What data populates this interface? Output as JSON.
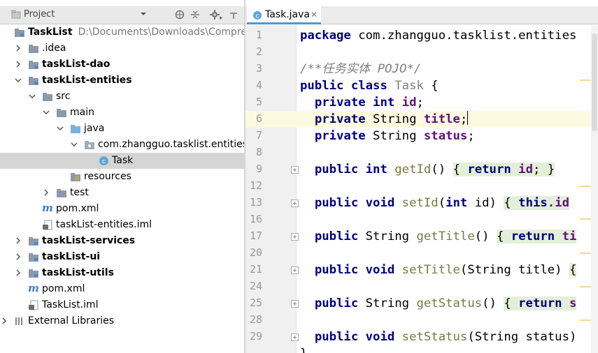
{
  "project_panel": {
    "title": "Project",
    "tree": [
      {
        "label": "TaskList",
        "path": "D:\\Documents\\Downloads\\Compres",
        "bold": true
      },
      {
        "label": ".idea"
      },
      {
        "label": "taskList-dao",
        "bold": true
      },
      {
        "label": "taskList-entities",
        "bold": true
      },
      {
        "label": "src"
      },
      {
        "label": "main"
      },
      {
        "label": "java"
      },
      {
        "label": "com.zhangguo.tasklist.entities"
      },
      {
        "label": "Task"
      },
      {
        "label": "resources"
      },
      {
        "label": "test"
      },
      {
        "label": "pom.xml"
      },
      {
        "label": "taskList-entities.iml"
      },
      {
        "label": "taskList-services",
        "bold": true
      },
      {
        "label": "taskList-ui",
        "bold": true
      },
      {
        "label": "taskList-utils",
        "bold": true
      },
      {
        "label": "pom.xml"
      },
      {
        "label": "TaskList.iml"
      },
      {
        "label": "External Libraries"
      }
    ]
  },
  "editor": {
    "tab": {
      "label": "Task.java"
    },
    "line_numbers": [
      "1",
      "2",
      "3",
      "4",
      "5",
      "6",
      "7",
      "8",
      "9",
      "12",
      "13",
      "16",
      "17",
      "20",
      "21",
      "24",
      "25",
      "28",
      "29"
    ],
    "code": {
      "l1_kw": "package",
      "l1_pkg": " com.zhangguo.tasklist.entities",
      "l3_comment": "/**任务实体 POJO*/",
      "l4_kw": "public class",
      "l4_name": "Task",
      "l4_rest": " {",
      "l5_kw": "private int",
      "l5_field": "id",
      "l6_kw": "private",
      "l6_type": " String ",
      "l6_field": "title",
      "l7_kw": "private",
      "l7_type": " String ",
      "l7_field": "status",
      "l9_kw": "public int",
      "l9_m": "getId",
      "l9_p": "()",
      "l9_open": "{",
      "l9_ret": "return",
      "l9_f": "id",
      "l9_end": "; }",
      "l13_kw": "public void",
      "l13_m": "setId",
      "l13_p1": "(",
      "l13_kw2": "int",
      "l13_p2": " id) ",
      "l13_open": "{",
      "l13_this": "this",
      "l13_f": ".id",
      "l17_kw": "public",
      "l17_type": " String ",
      "l17_m": "getTitle",
      "l17_p": "()",
      "l17_open": "{",
      "l17_ret": "return",
      "l17_f": "ti",
      "l21_kw": "public void",
      "l21_m": "setTitle",
      "l21_p": "(String title)",
      "l21_open": "{",
      "l25_kw": "public",
      "l25_type": " String ",
      "l25_m": "getStatus",
      "l25_p": "()",
      "l25_open": "{",
      "l25_ret": "return",
      "l25_f": "s",
      "l29_kw": "public void",
      "l29_m": "setStatus",
      "l29_p": "(String status)",
      "l30": "}"
    }
  },
  "colors": {
    "keyword": "#000080",
    "field": "#660e7a",
    "comment": "#808080",
    "caret_line": "#fcfae0",
    "tab_underline": "#4a9ad6"
  },
  "icons": [
    "project-folder-icon",
    "chevron-down-icon",
    "globe-icon",
    "collapse-icon",
    "gear-icon",
    "folder-icon",
    "module-folder-icon",
    "source-folder-icon",
    "package-icon",
    "class-icon",
    "resources-folder-icon",
    "maven-icon",
    "iml-file-icon",
    "library-icon",
    "close-icon",
    "fold-icon"
  ]
}
